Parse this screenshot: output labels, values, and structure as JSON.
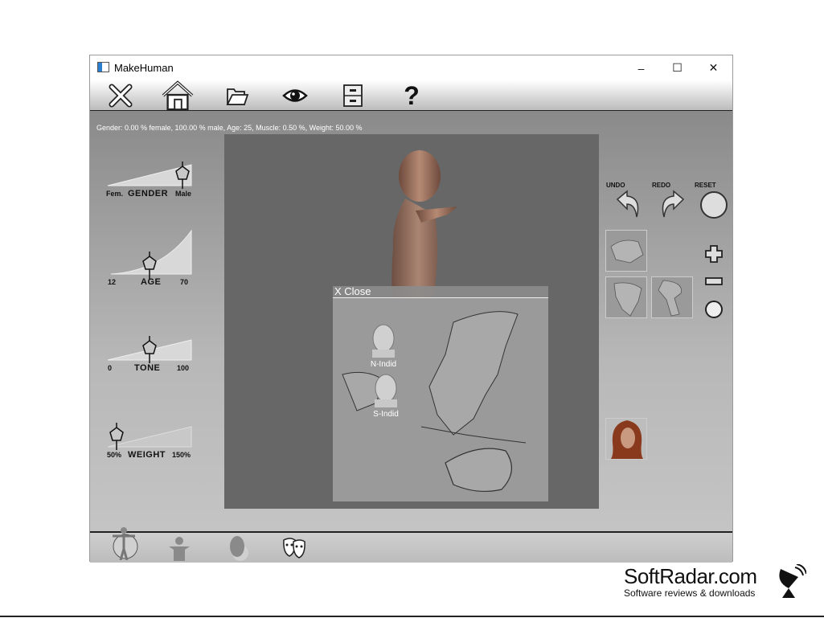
{
  "window": {
    "title": "MakeHuman",
    "controls": {
      "minimize": "–",
      "maximize": "☐",
      "close": "✕"
    }
  },
  "toolbar": {
    "items": [
      {
        "name": "exit",
        "icon": "x-icon"
      },
      {
        "name": "home",
        "icon": "home-icon"
      },
      {
        "name": "load",
        "icon": "folder-icon"
      },
      {
        "name": "view",
        "icon": "eye-icon"
      },
      {
        "name": "save",
        "icon": "save-icon"
      },
      {
        "name": "help",
        "icon": "help-icon",
        "glyph": "?"
      }
    ]
  },
  "status": {
    "text": "Gender: 0.00 % female, 100.00 % male, Age: 25, Muscle: 0.50 %, Weight: 50.00 %"
  },
  "sliders": {
    "gender": {
      "label": "GENDER",
      "min_label": "Fem.",
      "max_label": "Male",
      "value": 1.0
    },
    "age": {
      "label": "AGE",
      "min_label": "12",
      "max_label": "70",
      "value": 0.22
    },
    "tone": {
      "label": "TONE",
      "min_label": "0",
      "max_label": "100",
      "value": 0.5
    },
    "weight": {
      "label": "WEIGHT",
      "min_label": "50%",
      "max_label": "150%",
      "value": 0.0
    }
  },
  "popup": {
    "close_label": "X Close",
    "faces": [
      {
        "label": "N-Indid"
      },
      {
        "label": "S-Indid"
      }
    ]
  },
  "history": {
    "undo_label": "UNDO",
    "redo_label": "REDO",
    "reset_label": "RESET"
  },
  "zoom": {
    "plus": "+",
    "minus": "−"
  },
  "bottombar": {
    "items": [
      {
        "name": "body",
        "icon": "full-body-icon"
      },
      {
        "name": "torso",
        "icon": "torso-icon"
      },
      {
        "name": "head",
        "icon": "head-icon"
      },
      {
        "name": "expression",
        "icon": "masks-icon"
      }
    ]
  },
  "watermark": {
    "title": "SoftRadar.com",
    "subtitle": "Software reviews & downloads"
  }
}
